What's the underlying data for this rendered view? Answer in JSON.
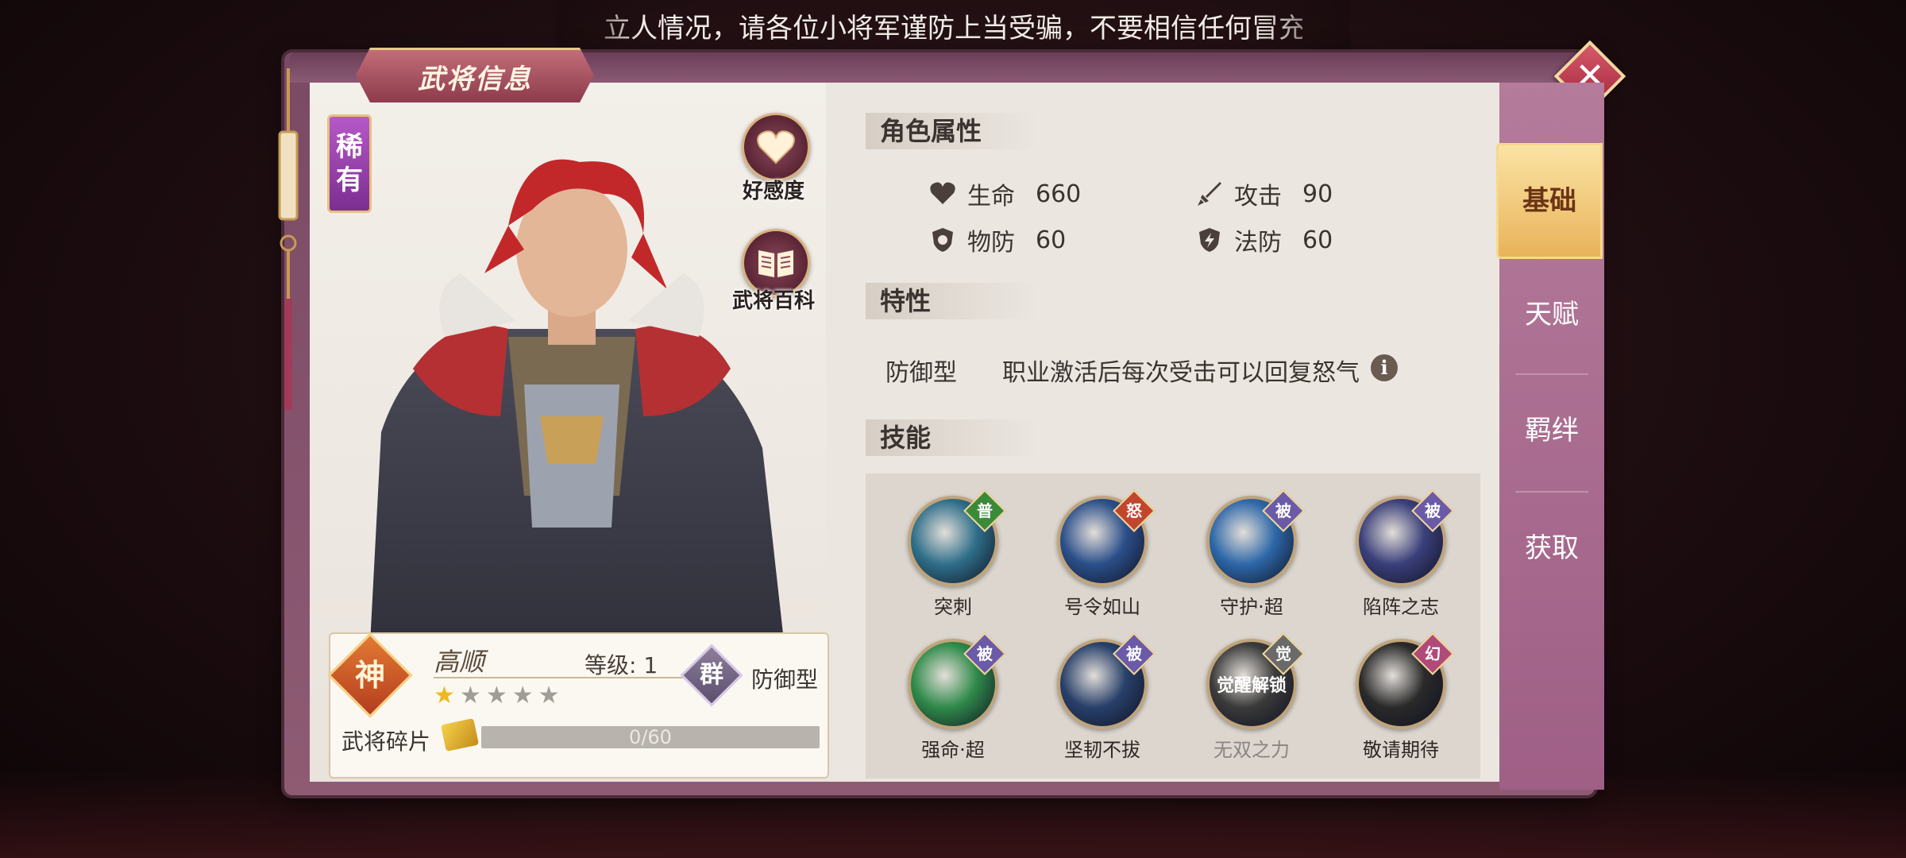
{
  "ticker": {
    "text": "立人情况，请各位小将军谨防上当受骗，不要相信任何冒充"
  },
  "panel": {
    "title": "武将信息",
    "close_icon": "close-x-icon"
  },
  "hero": {
    "rarity": "稀有",
    "favor_label": "好感度",
    "encyclopedia_label": "武将百科",
    "tier_badge": "神",
    "name": "高顺",
    "level_text": "等级: 1",
    "faction_badge": "群",
    "type_label": "防御型",
    "stars": {
      "filled": 1,
      "total": 5
    },
    "fragments": {
      "label": "武将碎片",
      "progress_text": "0/60",
      "current": 0,
      "required": 60
    }
  },
  "attributes": {
    "title": "角色属性",
    "items": [
      {
        "label": "生命",
        "value": "660",
        "icon": "heart-icon"
      },
      {
        "label": "攻击",
        "value": "90",
        "icon": "sword-icon"
      },
      {
        "label": "物防",
        "value": "60",
        "icon": "shield-icon"
      },
      {
        "label": "法防",
        "value": "60",
        "icon": "magic-shield-icon"
      }
    ]
  },
  "traits": {
    "title": "特性",
    "type": "防御型",
    "description": "职业激活后每次受击可以回复怒气",
    "info_icon": "i"
  },
  "skills": {
    "title": "技能",
    "items": [
      {
        "name": "突刺",
        "tag": "普",
        "tag_color": "#3b8a3a",
        "orb": "#2f6f8a"
      },
      {
        "name": "号令如山",
        "tag": "怒",
        "tag_color": "#c0462e",
        "orb": "#2b4f8a"
      },
      {
        "name": "守护·超",
        "tag": "被",
        "tag_color": "#6a5aa8",
        "orb": "#2d67a8"
      },
      {
        "name": "陷阵之志",
        "tag": "被",
        "tag_color": "#6a5aa8",
        "orb": "#3a3f7a"
      },
      {
        "name": "强命·超",
        "tag": "被",
        "tag_color": "#6a5aa8",
        "orb": "#2f8a4a"
      },
      {
        "name": "坚韧不拔",
        "tag": "被",
        "tag_color": "#6a5aa8",
        "orb": "#28406a"
      },
      {
        "name": "无双之力",
        "tag": "觉",
        "tag_color": "#6a6a6a",
        "orb": "#3a3a3a",
        "center_text": "觉醒解锁",
        "dim": true
      },
      {
        "name": "敬请期待",
        "tag": "幻",
        "tag_color": "#b04a78",
        "orb": "#2a2a2a"
      }
    ]
  },
  "tabs": [
    "基础",
    "天赋",
    "羁绊",
    "获取"
  ],
  "colors": {
    "accent": "#e8b35a",
    "panel": "#ebe6e0",
    "frame": "#8e5b73"
  }
}
